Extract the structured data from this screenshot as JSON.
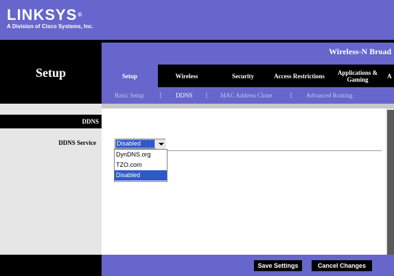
{
  "header": {
    "brand": "LINKSYS",
    "brand_reg": "®",
    "tagline": "A Division of Cisco Systems, Inc.",
    "product": "Wireless-N Broad",
    "section_title": "Setup"
  },
  "tabs": [
    {
      "label": "Setup"
    },
    {
      "label": "Wireless"
    },
    {
      "label": "Security"
    },
    {
      "label": "Access Restrictions"
    },
    {
      "label": "Applications & Gaming"
    },
    {
      "label": "A"
    }
  ],
  "subnav": {
    "items": [
      {
        "label": "Basic Setup"
      },
      {
        "label": "DDNS"
      },
      {
        "label": "MAC Address Clone"
      },
      {
        "label": "Advanced Routing"
      }
    ],
    "separator": "|"
  },
  "ddns": {
    "section_label": "DDNS",
    "service_label": "DDNS Service",
    "service_value": "Disabled",
    "options": [
      "DynDNS.org",
      "TZO.com",
      "Disabled"
    ]
  },
  "footer": {
    "save_label": "Save Settings",
    "cancel_label": "Cancel Changes"
  },
  "colors": {
    "brand_purple": "#6666cc",
    "select_highlight": "#2f59c9"
  }
}
